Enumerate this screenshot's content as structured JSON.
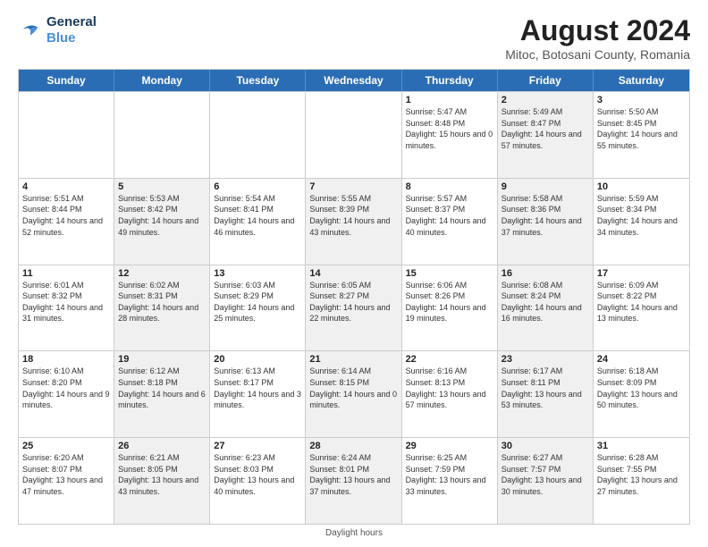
{
  "logo": {
    "line1": "General",
    "line2": "Blue"
  },
  "title": "August 2024",
  "subtitle": "Mitoc, Botosani County, Romania",
  "days_of_week": [
    "Sunday",
    "Monday",
    "Tuesday",
    "Wednesday",
    "Thursday",
    "Friday",
    "Saturday"
  ],
  "footer": "Daylight hours",
  "weeks": [
    [
      {
        "day": "",
        "empty": true,
        "shaded": false
      },
      {
        "day": "",
        "empty": true,
        "shaded": false
      },
      {
        "day": "",
        "empty": true,
        "shaded": false
      },
      {
        "day": "",
        "empty": true,
        "shaded": false
      },
      {
        "day": "1",
        "sunrise": "5:47 AM",
        "sunset": "8:48 PM",
        "daylight": "15 hours and 0 minutes.",
        "shaded": false
      },
      {
        "day": "2",
        "sunrise": "5:49 AM",
        "sunset": "8:47 PM",
        "daylight": "14 hours and 57 minutes.",
        "shaded": true
      },
      {
        "day": "3",
        "sunrise": "5:50 AM",
        "sunset": "8:45 PM",
        "daylight": "14 hours and 55 minutes.",
        "shaded": false
      }
    ],
    [
      {
        "day": "4",
        "sunrise": "5:51 AM",
        "sunset": "8:44 PM",
        "daylight": "14 hours and 52 minutes.",
        "shaded": false
      },
      {
        "day": "5",
        "sunrise": "5:53 AM",
        "sunset": "8:42 PM",
        "daylight": "14 hours and 49 minutes.",
        "shaded": true
      },
      {
        "day": "6",
        "sunrise": "5:54 AM",
        "sunset": "8:41 PM",
        "daylight": "14 hours and 46 minutes.",
        "shaded": false
      },
      {
        "day": "7",
        "sunrise": "5:55 AM",
        "sunset": "8:39 PM",
        "daylight": "14 hours and 43 minutes.",
        "shaded": true
      },
      {
        "day": "8",
        "sunrise": "5:57 AM",
        "sunset": "8:37 PM",
        "daylight": "14 hours and 40 minutes.",
        "shaded": false
      },
      {
        "day": "9",
        "sunrise": "5:58 AM",
        "sunset": "8:36 PM",
        "daylight": "14 hours and 37 minutes.",
        "shaded": true
      },
      {
        "day": "10",
        "sunrise": "5:59 AM",
        "sunset": "8:34 PM",
        "daylight": "14 hours and 34 minutes.",
        "shaded": false
      }
    ],
    [
      {
        "day": "11",
        "sunrise": "6:01 AM",
        "sunset": "8:32 PM",
        "daylight": "14 hours and 31 minutes.",
        "shaded": false
      },
      {
        "day": "12",
        "sunrise": "6:02 AM",
        "sunset": "8:31 PM",
        "daylight": "14 hours and 28 minutes.",
        "shaded": true
      },
      {
        "day": "13",
        "sunrise": "6:03 AM",
        "sunset": "8:29 PM",
        "daylight": "14 hours and 25 minutes.",
        "shaded": false
      },
      {
        "day": "14",
        "sunrise": "6:05 AM",
        "sunset": "8:27 PM",
        "daylight": "14 hours and 22 minutes.",
        "shaded": true
      },
      {
        "day": "15",
        "sunrise": "6:06 AM",
        "sunset": "8:26 PM",
        "daylight": "14 hours and 19 minutes.",
        "shaded": false
      },
      {
        "day": "16",
        "sunrise": "6:08 AM",
        "sunset": "8:24 PM",
        "daylight": "14 hours and 16 minutes.",
        "shaded": true
      },
      {
        "day": "17",
        "sunrise": "6:09 AM",
        "sunset": "8:22 PM",
        "daylight": "14 hours and 13 minutes.",
        "shaded": false
      }
    ],
    [
      {
        "day": "18",
        "sunrise": "6:10 AM",
        "sunset": "8:20 PM",
        "daylight": "14 hours and 9 minutes.",
        "shaded": false
      },
      {
        "day": "19",
        "sunrise": "6:12 AM",
        "sunset": "8:18 PM",
        "daylight": "14 hours and 6 minutes.",
        "shaded": true
      },
      {
        "day": "20",
        "sunrise": "6:13 AM",
        "sunset": "8:17 PM",
        "daylight": "14 hours and 3 minutes.",
        "shaded": false
      },
      {
        "day": "21",
        "sunrise": "6:14 AM",
        "sunset": "8:15 PM",
        "daylight": "14 hours and 0 minutes.",
        "shaded": true
      },
      {
        "day": "22",
        "sunrise": "6:16 AM",
        "sunset": "8:13 PM",
        "daylight": "13 hours and 57 minutes.",
        "shaded": false
      },
      {
        "day": "23",
        "sunrise": "6:17 AM",
        "sunset": "8:11 PM",
        "daylight": "13 hours and 53 minutes.",
        "shaded": true
      },
      {
        "day": "24",
        "sunrise": "6:18 AM",
        "sunset": "8:09 PM",
        "daylight": "13 hours and 50 minutes.",
        "shaded": false
      }
    ],
    [
      {
        "day": "25",
        "sunrise": "6:20 AM",
        "sunset": "8:07 PM",
        "daylight": "13 hours and 47 minutes.",
        "shaded": false
      },
      {
        "day": "26",
        "sunrise": "6:21 AM",
        "sunset": "8:05 PM",
        "daylight": "13 hours and 43 minutes.",
        "shaded": true
      },
      {
        "day": "27",
        "sunrise": "6:23 AM",
        "sunset": "8:03 PM",
        "daylight": "13 hours and 40 minutes.",
        "shaded": false
      },
      {
        "day": "28",
        "sunrise": "6:24 AM",
        "sunset": "8:01 PM",
        "daylight": "13 hours and 37 minutes.",
        "shaded": true
      },
      {
        "day": "29",
        "sunrise": "6:25 AM",
        "sunset": "7:59 PM",
        "daylight": "13 hours and 33 minutes.",
        "shaded": false
      },
      {
        "day": "30",
        "sunrise": "6:27 AM",
        "sunset": "7:57 PM",
        "daylight": "13 hours and 30 minutes.",
        "shaded": true
      },
      {
        "day": "31",
        "sunrise": "6:28 AM",
        "sunset": "7:55 PM",
        "daylight": "13 hours and 27 minutes.",
        "shaded": false
      }
    ]
  ]
}
